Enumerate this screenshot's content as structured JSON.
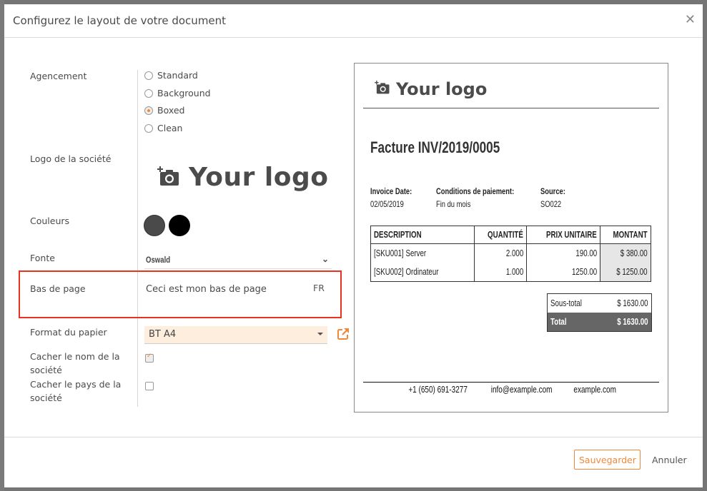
{
  "dialog": {
    "title": "Configurez le layout de votre document",
    "close_icon": "close-icon"
  },
  "form": {
    "layout": {
      "label": "Agencement",
      "options": [
        {
          "label": "Standard",
          "checked": false
        },
        {
          "label": "Background",
          "checked": false
        },
        {
          "label": "Boxed",
          "checked": true
        },
        {
          "label": "Clean",
          "checked": false
        }
      ]
    },
    "logo": {
      "label": "Logo de la société",
      "placeholder_text": "Your logo",
      "icon": "add-camera-icon"
    },
    "colors": {
      "label": "Couleurs",
      "primary": "#4a4a4a",
      "secondary": "#000000"
    },
    "font": {
      "label": "Fonte",
      "value": "Oswald"
    },
    "footer": {
      "label": "Bas de page",
      "value": "Ceci est mon bas de page",
      "lang": "FR"
    },
    "paper_format": {
      "label": "Format du papier",
      "value": "BT A4",
      "external_link_icon": "external-link-icon"
    },
    "hide_company_name": {
      "label": "Cacher le nom de la société",
      "checked": true
    },
    "hide_company_country": {
      "label": "Cacher le pays de la société",
      "checked": false
    }
  },
  "preview": {
    "logo_text": "Your logo",
    "title": "Facture INV/2019/0005",
    "info": [
      {
        "key": "Invoice Date:",
        "value": "02/05/2019"
      },
      {
        "key": "Conditions de paiement:",
        "value": "Fin du mois"
      },
      {
        "key": "Source:",
        "value": "SO022"
      }
    ],
    "table": {
      "headers": [
        "DESCRIPTION",
        "QUANTITÉ",
        "PRIX UNITAIRE",
        "MONTANT"
      ],
      "rows": [
        [
          "[SKU001] Server",
          "2.000",
          "190.00",
          "$ 380.00"
        ],
        [
          "[SKU002] Ordinateur",
          "1.000",
          "1250.00",
          "$ 1250.00"
        ]
      ]
    },
    "totals": {
      "subtotal_label": "Sous-total",
      "subtotal_value": "$ 1630.00",
      "total_label": "Total",
      "total_value": "$ 1630.00"
    },
    "footer": {
      "phone": "+1 (650) 691-3277",
      "email": "info@example.com",
      "website": "example.com"
    }
  },
  "actions": {
    "save": "Sauvegarder",
    "cancel": "Annuler"
  },
  "theme": {
    "accent": "#f0883a",
    "highlight_box": "#e8321e"
  }
}
